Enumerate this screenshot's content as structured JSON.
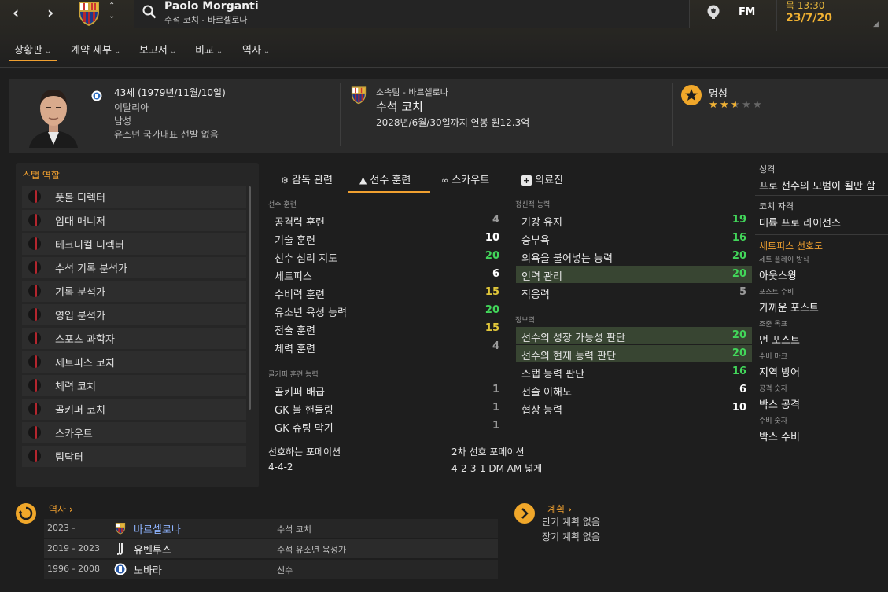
{
  "top": {
    "person_name": "Paolo Morganti",
    "person_sub": "수석 코치 - 바르셀로나",
    "fm_label": "FM",
    "day_time": "목 13:30",
    "date": "23/7/20"
  },
  "nav": {
    "tabs": [
      "상황판",
      "계약 세부",
      "보고서",
      "비교",
      "역사"
    ]
  },
  "profile": {
    "age_birth": "43세 (1979년/11월/10일)",
    "nationality": "이탈리아",
    "gender": "남성",
    "youth_caps": "유소년 국가대표 선발 없음",
    "club_label": "소속팀 - 바르셀로나",
    "job": "수석 코치",
    "contract": "2028년/6월/30일까지 연봉 원12.3억",
    "reputation_label": "명성",
    "reputation_stars": 2.5
  },
  "roles": {
    "title": "스탭 역할",
    "items": [
      "풋볼 디렉터",
      "임대 매니저",
      "테크니컬 디렉터",
      "수석 기록 분석가",
      "기록 분석가",
      "영입 분석가",
      "스포츠 과학자",
      "세트피스 코치",
      "체력 코치",
      "골키퍼 코치",
      "스카우트",
      "팀닥터"
    ]
  },
  "attr_tabs": [
    "감독 관련",
    "선수 훈련",
    "스카우트",
    "의료진"
  ],
  "coaching": {
    "label": "선수 훈련",
    "items": [
      {
        "name": "공격력 훈련",
        "value": "4",
        "color": "gray"
      },
      {
        "name": "기술 훈련",
        "value": "10",
        "color": "white"
      },
      {
        "name": "선수 심리 지도",
        "value": "20",
        "color": "green"
      },
      {
        "name": "세트피스",
        "value": "6",
        "color": "white"
      },
      {
        "name": "수비력 훈련",
        "value": "15",
        "color": "yellow"
      },
      {
        "name": "유소년 육성 능력",
        "value": "20",
        "color": "green"
      },
      {
        "name": "전술 훈련",
        "value": "15",
        "color": "yellow"
      },
      {
        "name": "체력 훈련",
        "value": "4",
        "color": "gray"
      }
    ]
  },
  "gk": {
    "label": "골키퍼 훈련 능력",
    "items": [
      {
        "name": "골키퍼 배급",
        "value": "1",
        "color": "gray"
      },
      {
        "name": "GK 볼 핸들링",
        "value": "1",
        "color": "gray"
      },
      {
        "name": "GK 슈팅 막기",
        "value": "1",
        "color": "gray"
      }
    ]
  },
  "mental": {
    "label": "정신적 능력",
    "items": [
      {
        "name": "기강 유지",
        "value": "19",
        "color": "green"
      },
      {
        "name": "승부욕",
        "value": "16",
        "color": "green"
      },
      {
        "name": "의욕을 불어넣는 능력",
        "value": "20",
        "color": "green"
      },
      {
        "name": "인력 관리",
        "value": "20",
        "color": "green",
        "hl": true
      },
      {
        "name": "적응력",
        "value": "5",
        "color": "gray"
      }
    ]
  },
  "knowledge": {
    "label": "정보력",
    "items": [
      {
        "name": "선수의 성장 가능성 판단",
        "value": "20",
        "color": "green",
        "hl": true
      },
      {
        "name": "선수의 현재 능력 판단",
        "value": "20",
        "color": "green",
        "hl": true
      },
      {
        "name": "스탭 능력 판단",
        "value": "16",
        "color": "green"
      },
      {
        "name": "전술 이해도",
        "value": "6",
        "color": "white"
      },
      {
        "name": "협상 능력",
        "value": "10",
        "color": "white"
      }
    ]
  },
  "formations": {
    "pref_label": "선호하는 포메이션",
    "pref_value": "4-4-2",
    "second_label": "2차 선호 포메이션",
    "second_value": "4-2-3-1 DM AM 넓게"
  },
  "right": {
    "personality_label": "성격",
    "personality_value": "프로 선수의 모범이 될만 함",
    "badge_label": "코치 자격",
    "badge_value": "대륙 프로 라이선스",
    "setpiece_title": "세트피스 선호도",
    "pairs": [
      {
        "label": "세트 플레이 방식",
        "value": "아웃스윙"
      },
      {
        "label": "포스트 수비",
        "value": "가까운 포스트"
      },
      {
        "label": "조준 목표",
        "value": "먼 포스트"
      },
      {
        "label": "수비 마크",
        "value": "지역 방어"
      },
      {
        "label": "공격 숫자",
        "value": "박스 공격"
      },
      {
        "label": "수비 숫자",
        "value": "박스 수비"
      }
    ]
  },
  "history": {
    "title": "역사",
    "rows": [
      {
        "years": "2023 -",
        "club": "바르셀로나",
        "role": "수석 코치"
      },
      {
        "years": "2019 - 2023",
        "club": "유벤투스",
        "role": "수석 유소년 육성가"
      },
      {
        "years": "1996 - 2008",
        "club": "노바라",
        "role": "선수"
      }
    ]
  },
  "plans": {
    "title": "계획",
    "short": "단기 계획 없음",
    "long": "장기 계획 없음"
  },
  "colors": {
    "accent": "#f0a030",
    "green": "#42d65a",
    "yellow": "#e0c63a",
    "highlight": "#384532"
  }
}
